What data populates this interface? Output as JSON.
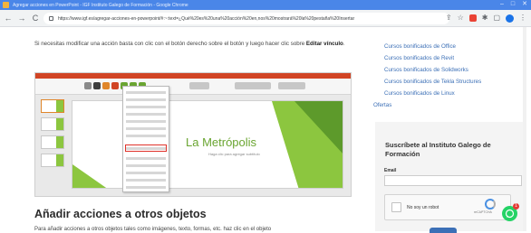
{
  "window": {
    "title": "Agregar acciones en PowerPoint - IGF Instituto Galego de Formación - Google Chrome",
    "controls": [
      "–",
      "□",
      "✕"
    ]
  },
  "browser": {
    "back": "←",
    "forward": "→",
    "reload": "C",
    "home": "⌂",
    "url": "https://www.igf.es/agregar-acciones-en-powerpoint/#:~:text=¿Qué%20es%20una%20acción%20en,nos%20mostrará%20la%20pestaña%20Insertar"
  },
  "article": {
    "para1_text": "Si necesitas modificar una acción basta con clic con el botón derecho sobre el botón y luego hacer clic sobre ",
    "para1_bold": "Editar vínculo",
    "para1_end": ".",
    "slide_title": "La Metrópolis",
    "slide_subtitle": "Haga clic para agregar subtítulo",
    "heading": "Añadir acciones a otros objetos",
    "para2": "Para añadir acciones a otros objetos tales como imágenes, texto, formas, etc. haz clic en el objeto"
  },
  "sidebar": {
    "links": [
      "Cursos bonificados de Office",
      "Cursos bonificados de Revit",
      "Cursos bonificados de Solidworks",
      "Cursos bonificados de Tekla Structures",
      "Cursos bonificados de Linux"
    ],
    "offers": "Ofertas",
    "subscribe_title": "Suscríbete al Instituto Galego de Formación",
    "email_label": "Email",
    "captcha_label": "No soy un robot",
    "captcha_brand": "reCAPTCHA",
    "whatsapp_badge": "1"
  },
  "colors": {
    "chrome_blue": "#4a86e8",
    "link_blue": "#3b6fb6",
    "slide_green": "#6aa531",
    "ppt_red": "#d14424",
    "whatsapp_green": "#25d366"
  }
}
